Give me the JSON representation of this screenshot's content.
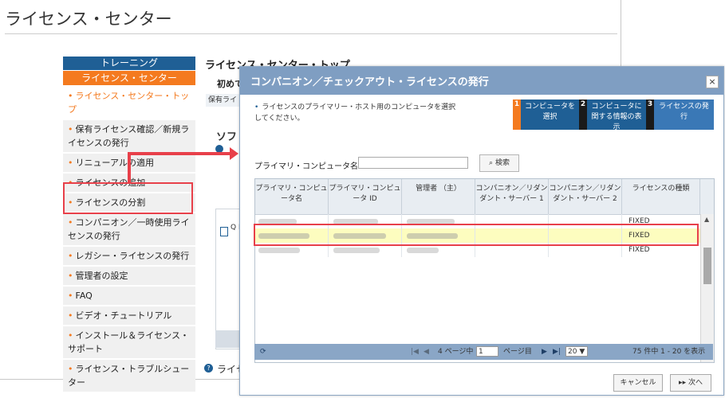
{
  "page": {
    "title": "ライセンス・センター"
  },
  "sidebar": {
    "header_training": "トレーニング",
    "header_lc": "ライセンス・センター",
    "items": [
      {
        "label": "ライセンス・センター・トップ",
        "active": true
      },
      {
        "label": "保有ライセンス確認／新規ライセンスの発行"
      },
      {
        "label": "リニューアルの適用"
      },
      {
        "label": "ライセンスの追加"
      },
      {
        "label": "ライセンスの分割"
      },
      {
        "label": "コンパニオン／一時使用ライセンスの発行"
      },
      {
        "label": "レガシー・ライセンスの発行"
      },
      {
        "label": "管理者の設定"
      },
      {
        "label": "FAQ"
      },
      {
        "label": "ビデオ・チュートリアル"
      },
      {
        "label": "インストール＆ライセンス・サポート"
      },
      {
        "label": "ライセンス・トラブルシューター"
      }
    ]
  },
  "background_content": {
    "heading": "ライセンス・センター・トップ",
    "intro": "初めて",
    "band": "保有ライ",
    "section": "ソフ",
    "table_cell": "Q Fi",
    "footer_link": "ライセ"
  },
  "dialog": {
    "title": "コンパニオン／チェックアウト・ライセンスの発行",
    "close_glyph": "×",
    "instruction": "ライセンスのプライマリー・ホスト用のコンピュータを選択してください。",
    "steps": [
      {
        "num": "1",
        "label": "コンピュータを選択"
      },
      {
        "num": "2",
        "label": "コンピュータに関する情報の表示"
      },
      {
        "num": "3",
        "label": "ライセンスの発行"
      }
    ],
    "search": {
      "label": "プライマリ・コンピュータ名",
      "value": "",
      "button": "検索"
    },
    "grid": {
      "columns": [
        "プライマリ・コンピュータ名",
        "プライマリ・コンピュータ ID",
        "管理者 （主）",
        "コンパニオン／リダンダント・サーバー 1",
        "コンパニオン／リダンダント・サーバー 2",
        "ライセンスの種類"
      ],
      "rows": [
        {
          "type": "FIXED",
          "selected": false
        },
        {
          "type": "FIXED",
          "selected": true
        },
        {
          "type": "FIXED",
          "selected": false
        }
      ]
    },
    "pager": {
      "refresh": "⟳",
      "first": "|◀",
      "prev": "◀",
      "page_prefix": "4 ページ中",
      "page_value": "1",
      "page_suffix": "ページ目",
      "next": "▶",
      "last": "▶|",
      "page_size": "20 ▼",
      "summary": "75 件中 1 - 20 を表示"
    },
    "buttons": {
      "cancel": "キャンセル",
      "next": "▸▸ 次へ"
    }
  },
  "colors": {
    "brand_blue": "#1f5f95",
    "accent_orange": "#f47a1f",
    "highlight_red": "#e8404a",
    "selected_row": "#fdfdbf"
  }
}
